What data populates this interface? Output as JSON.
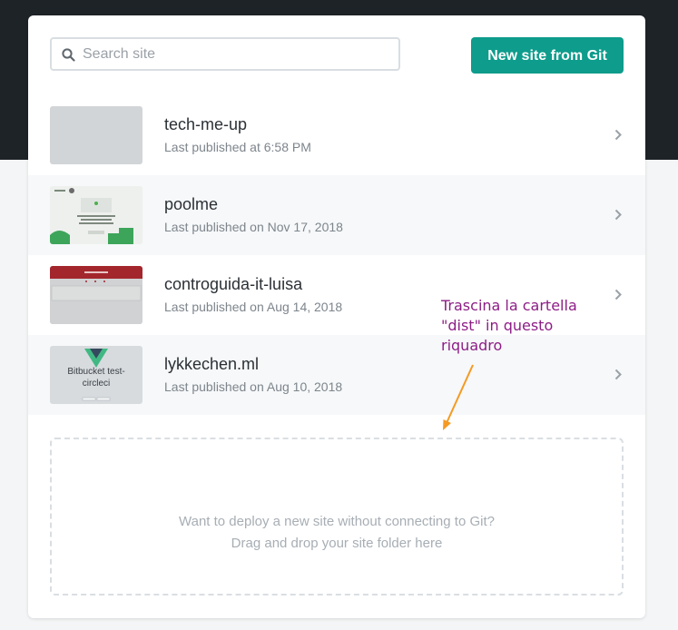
{
  "search": {
    "placeholder": "Search site",
    "value": ""
  },
  "actions": {
    "new_site_label": "New site from Git"
  },
  "sites": [
    {
      "name": "tech-me-up",
      "meta": "Last published at 6:58 PM",
      "thumb_text": ""
    },
    {
      "name": "poolme",
      "meta": "Last published on Nov 17, 2018",
      "thumb_text": ""
    },
    {
      "name": "controguida-it-luisa",
      "meta": "Last published on Aug 14, 2018",
      "thumb_text": ""
    },
    {
      "name": "lykkechen.ml",
      "meta": "Last published on Aug 10, 2018",
      "thumb_text": "Bitbucket test-circleci"
    }
  ],
  "dropzone": {
    "line1": "Want to deploy a new site without connecting to Git?",
    "line2": "Drag and drop your site folder here"
  },
  "annotation": {
    "text": "Trascina la cartella \"dist\" in questo riquadro"
  },
  "colors": {
    "header_bg": "#1e2328",
    "accent": "#0e9c8c",
    "annotation": "#8d1d86",
    "arrow": "#f59a23"
  }
}
